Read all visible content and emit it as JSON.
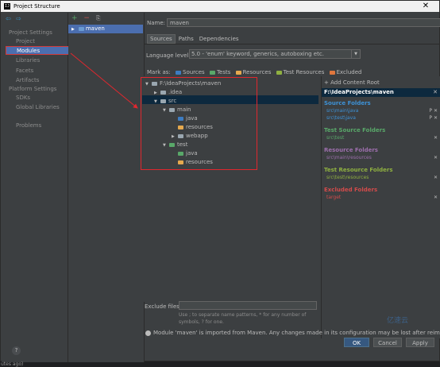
{
  "window": {
    "title": "Project Structure",
    "close_glyph": "✕"
  },
  "left": {
    "nav": {
      "back": "⇦",
      "forward": "⇨"
    },
    "project_settings_header": "Project Settings",
    "project_items": [
      "Project",
      "Modules",
      "Libraries",
      "Facets",
      "Artifacts"
    ],
    "platform_settings_header": "Platform Settings",
    "platform_items": [
      "SDKs",
      "Global Libraries"
    ],
    "problems": "Problems",
    "help": "?"
  },
  "middle": {
    "add": "+",
    "remove": "−",
    "copy": "⎘",
    "module_name": "maven"
  },
  "right": {
    "name_label": "Name:",
    "name_value": "maven",
    "tabs": [
      "Sources",
      "Paths",
      "Dependencies"
    ],
    "language_label": "Language level:",
    "language_value": "5.0 - 'enum' keyword, generics, autoboxing etc.",
    "mark_as_label": "Mark as:",
    "mark_as": [
      "Sources",
      "Tests",
      "Resources",
      "Test Resources",
      "Excluded"
    ],
    "tree": [
      {
        "label": "F:\\IdeaProjects\\maven",
        "indent": 0,
        "toggle": "▼",
        "icon": "gray"
      },
      {
        "label": ".idea",
        "indent": 1,
        "toggle": "▶",
        "icon": "gray"
      },
      {
        "label": "src",
        "indent": 1,
        "toggle": "▼",
        "icon": "gray"
      },
      {
        "label": "main",
        "indent": 2,
        "toggle": "▼",
        "icon": "gray"
      },
      {
        "label": "java",
        "indent": 3,
        "toggle": "",
        "icon": "blue"
      },
      {
        "label": "resources",
        "indent": 3,
        "toggle": "",
        "icon": "orange"
      },
      {
        "label": "webapp",
        "indent": 3,
        "toggle": "▶",
        "icon": "gray"
      },
      {
        "label": "test",
        "indent": 2,
        "toggle": "▼",
        "icon": "green"
      },
      {
        "label": "java",
        "indent": 3,
        "toggle": "",
        "icon": "green"
      },
      {
        "label": "resources",
        "indent": 3,
        "toggle": "",
        "icon": "orange"
      }
    ],
    "content_pane": {
      "add_content_root": "+ Add Content Root",
      "root_path": "F:\\IdeaProjects\\maven",
      "sections": [
        {
          "header": "Source Folders",
          "color": "#3d92d7",
          "items": [
            "src\\main\\java",
            "src\\test\\java"
          ]
        },
        {
          "header": "Test Source Folders",
          "color": "#59a869",
          "items": [
            "src\\test"
          ]
        },
        {
          "header": "Resource Folders",
          "color": "#9d6fad",
          "items": [
            "src\\main\\resources"
          ]
        },
        {
          "header": "Test Resource Folders",
          "color": "#8fb041",
          "items": [
            "src\\test\\resources"
          ]
        },
        {
          "header": "Excluded Folders",
          "color": "#d24b4b",
          "items": [
            "target"
          ]
        }
      ]
    },
    "exclude_files_label": "Exclude files:",
    "exclude_files_hint": "Use ; to separate name patterns, * for any number of symbols, ? for one.",
    "info_text": "Module 'maven' is imported from Maven. Any changes made in its configuration may be lost after reimporting."
  },
  "buttons": {
    "ok": "OK",
    "cancel": "Cancel",
    "apply": "Apply"
  },
  "status_text": "utes ago)",
  "watermark": "亿速云"
}
